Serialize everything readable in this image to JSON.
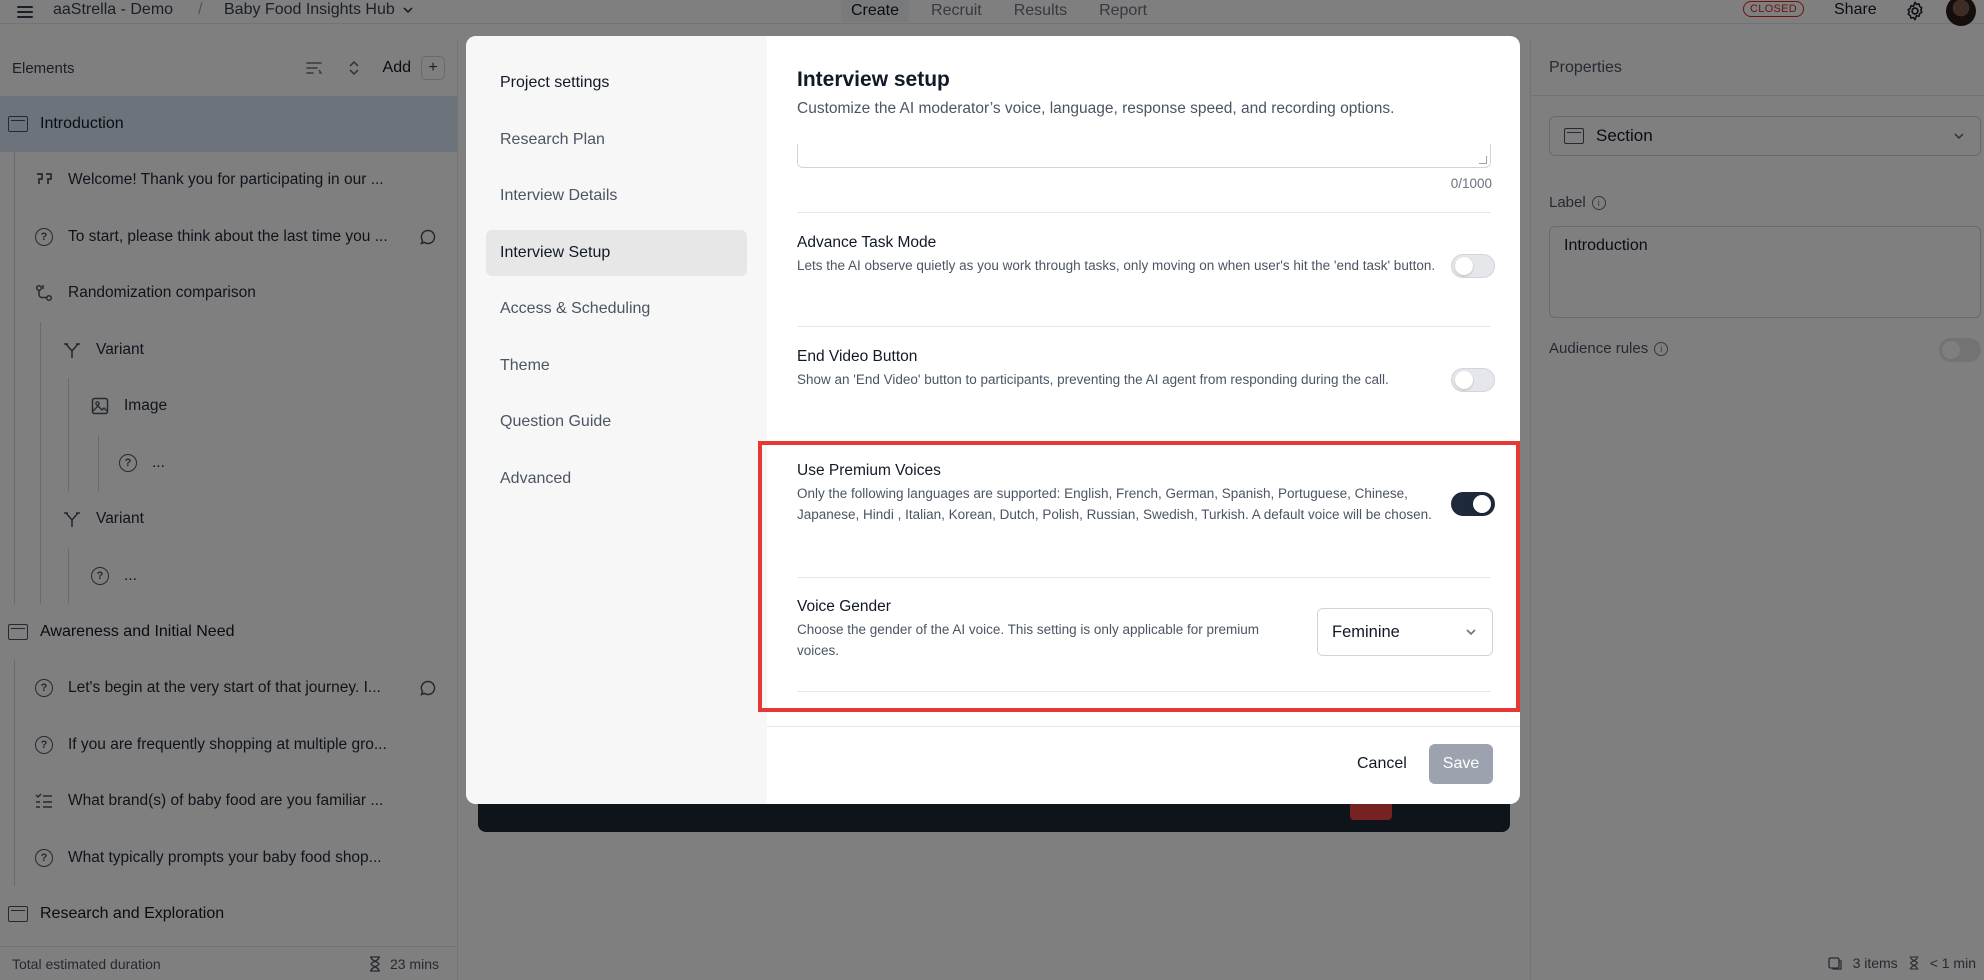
{
  "topbar": {
    "workspace": "aaStrella - Demo",
    "separator": "/",
    "project": "Baby Food Insights Hub",
    "tabs": [
      {
        "label": "Create",
        "active": true
      },
      {
        "label": "Recruit",
        "active": false
      },
      {
        "label": "Results",
        "active": false
      },
      {
        "label": "Report",
        "active": false
      }
    ],
    "status_badge": "CLOSED",
    "share_label": "Share"
  },
  "elements_panel": {
    "title": "Elements",
    "add_label": "Add",
    "items": [
      {
        "type": "section",
        "label": "Introduction"
      },
      {
        "type": "quote",
        "label": "Welcome! Thank you for participating in our ..."
      },
      {
        "type": "question",
        "label": "To start, please think about the last time you ..."
      },
      {
        "type": "randomization",
        "label": "Randomization comparison"
      },
      {
        "type": "variant",
        "label": "Variant"
      },
      {
        "type": "image",
        "label": "Image"
      },
      {
        "type": "question",
        "label": "..."
      },
      {
        "type": "variant",
        "label": "Variant"
      },
      {
        "type": "question",
        "label": "..."
      },
      {
        "type": "section",
        "label": "Awareness and Initial Need"
      },
      {
        "type": "question",
        "label": "Let's begin at the very start of that journey. I..."
      },
      {
        "type": "question",
        "label": "If you are frequently shopping at multiple gro..."
      },
      {
        "type": "list",
        "label": "What brand(s) of baby food are you familiar ..."
      },
      {
        "type": "question",
        "label": "What typically prompts your baby food shop..."
      },
      {
        "type": "section",
        "label": "Research and Exploration"
      }
    ],
    "footer_label": "Total estimated duration",
    "footer_value": "23 mins"
  },
  "properties_panel": {
    "title": "Properties",
    "type_value": "Section",
    "label_title": "Label",
    "label_value": "Introduction",
    "audience_rules": "Audience rules",
    "footer_items": "3 items",
    "footer_duration": "< 1 min"
  },
  "modal": {
    "nav": [
      {
        "label": "Project settings",
        "active": false
      },
      {
        "label": "Research Plan",
        "active": false
      },
      {
        "label": "Interview Details",
        "active": false
      },
      {
        "label": "Interview Setup",
        "active": true
      },
      {
        "label": "Access & Scheduling",
        "active": false
      },
      {
        "label": "Theme",
        "active": false
      },
      {
        "label": "Question Guide",
        "active": false
      },
      {
        "label": "Advanced",
        "active": false
      }
    ],
    "title": "Interview setup",
    "subtitle": "Customize the AI moderator’s voice, language, response speed, and recording options.",
    "counter": "0/1000",
    "settings": {
      "advance_task": {
        "title": "Advance Task Mode",
        "desc": "Lets the AI observe quietly as you work through tasks, only moving on when user's hit the 'end task' button.",
        "enabled": false
      },
      "end_video": {
        "title": "End Video Button",
        "desc": "Show an 'End Video' button to participants, preventing the AI agent from responding during the call.",
        "enabled": false
      },
      "premium_voices": {
        "title": "Use Premium Voices",
        "desc": "Only the following languages are supported: English, French, German, Spanish, Portuguese, Chinese, Japanese, Hindi , Italian, Korean, Dutch, Polish, Russian, Swedish, Turkish. A default voice will be chosen.",
        "enabled": true
      },
      "voice_gender": {
        "title": "Voice Gender",
        "desc": "Choose the gender of the AI voice. This setting is only applicable for premium voices.",
        "value": "Feminine"
      }
    },
    "cancel_label": "Cancel",
    "save_label": "Save"
  },
  "colors": {
    "highlight": "#e53935",
    "toggle_on": "#1e293b",
    "selected_section": "#dbe7f5",
    "closed_badge": "#dc2626"
  }
}
